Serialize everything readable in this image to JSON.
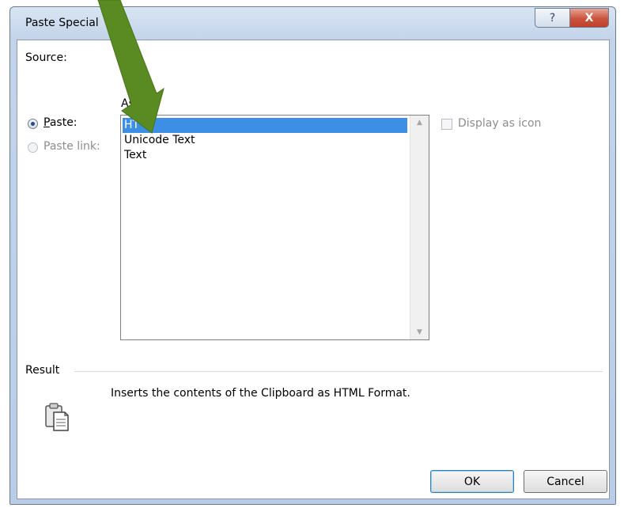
{
  "window": {
    "title": "Paste Special",
    "help_glyph": "?",
    "close_glyph": "X"
  },
  "source": {
    "label": "Source:"
  },
  "as_label": "As:",
  "options": {
    "paste": {
      "label": "Paste:",
      "accel": "P",
      "rest": "aste:",
      "checked": true
    },
    "paste_link": {
      "label": "Paste link:",
      "enabled": false
    }
  },
  "formats": {
    "items": [
      "HTML",
      "Unicode Text",
      "Text"
    ],
    "selected_index": 0,
    "selected_visible_text": "HT"
  },
  "display_as_icon": {
    "label": "Display as icon",
    "checked": false,
    "enabled": false
  },
  "result": {
    "label": "Result",
    "description": "Inserts the contents of the Clipboard as HTML Format."
  },
  "buttons": {
    "ok": "OK",
    "cancel": "Cancel"
  },
  "colors": {
    "selection": "#3c8fe4",
    "arrow": "#5a8a22",
    "close_button": "#c9543d"
  }
}
